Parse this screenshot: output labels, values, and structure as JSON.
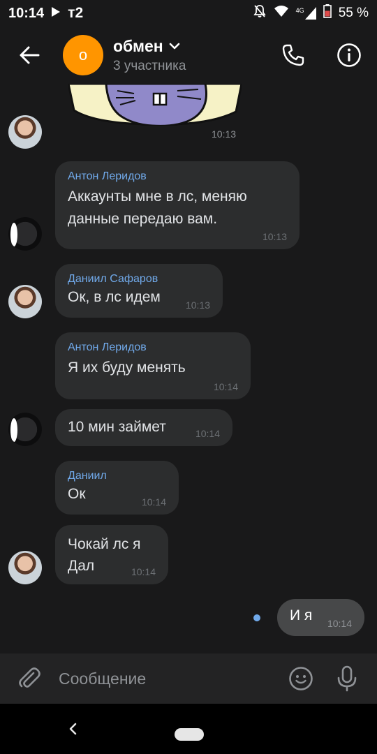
{
  "status_bar": {
    "time": "10:14",
    "carrier": "т2",
    "network": "4G",
    "battery": "55 %"
  },
  "header": {
    "avatar_letter": "о",
    "title": "обмен",
    "subtitle": "3 участника"
  },
  "colors": {
    "background": "#19191a",
    "bubble_in": "#2c2d2e",
    "bubble_out": "#474849",
    "sender_name": "#71aaeb",
    "chat_avatar": "#ff9500"
  },
  "messages": {
    "sticker_time": "10:13",
    "items": [
      {
        "sender": "Антон Леридов",
        "text": "Аккаунты мне в лс, меняю\nданные передаю вам.",
        "time": "10:13"
      },
      {
        "sender": "Даниил Сафаров",
        "text": "Ок, в лс идем",
        "time": "10:13"
      },
      {
        "sender": "Антон Леридов",
        "text": "Я их буду менять",
        "time": "10:14"
      },
      {
        "sender": "",
        "text": "10 мин займет",
        "time": "10:14"
      },
      {
        "sender": "Даниил",
        "text": "Ок",
        "time": "10:14"
      },
      {
        "sender": "",
        "text": "Чокай лс я\n Дал",
        "time": "10:14"
      }
    ],
    "outgoing": {
      "text": "И я",
      "time": "10:14"
    }
  },
  "composer": {
    "placeholder": "Сообщение"
  },
  "icons": {
    "back": "arrow-left-icon",
    "dropdown": "chevron-down-icon",
    "call": "phone-icon",
    "info": "info-icon",
    "attach": "paperclip-icon",
    "emoji": "smiley-icon",
    "mic": "microphone-icon"
  }
}
